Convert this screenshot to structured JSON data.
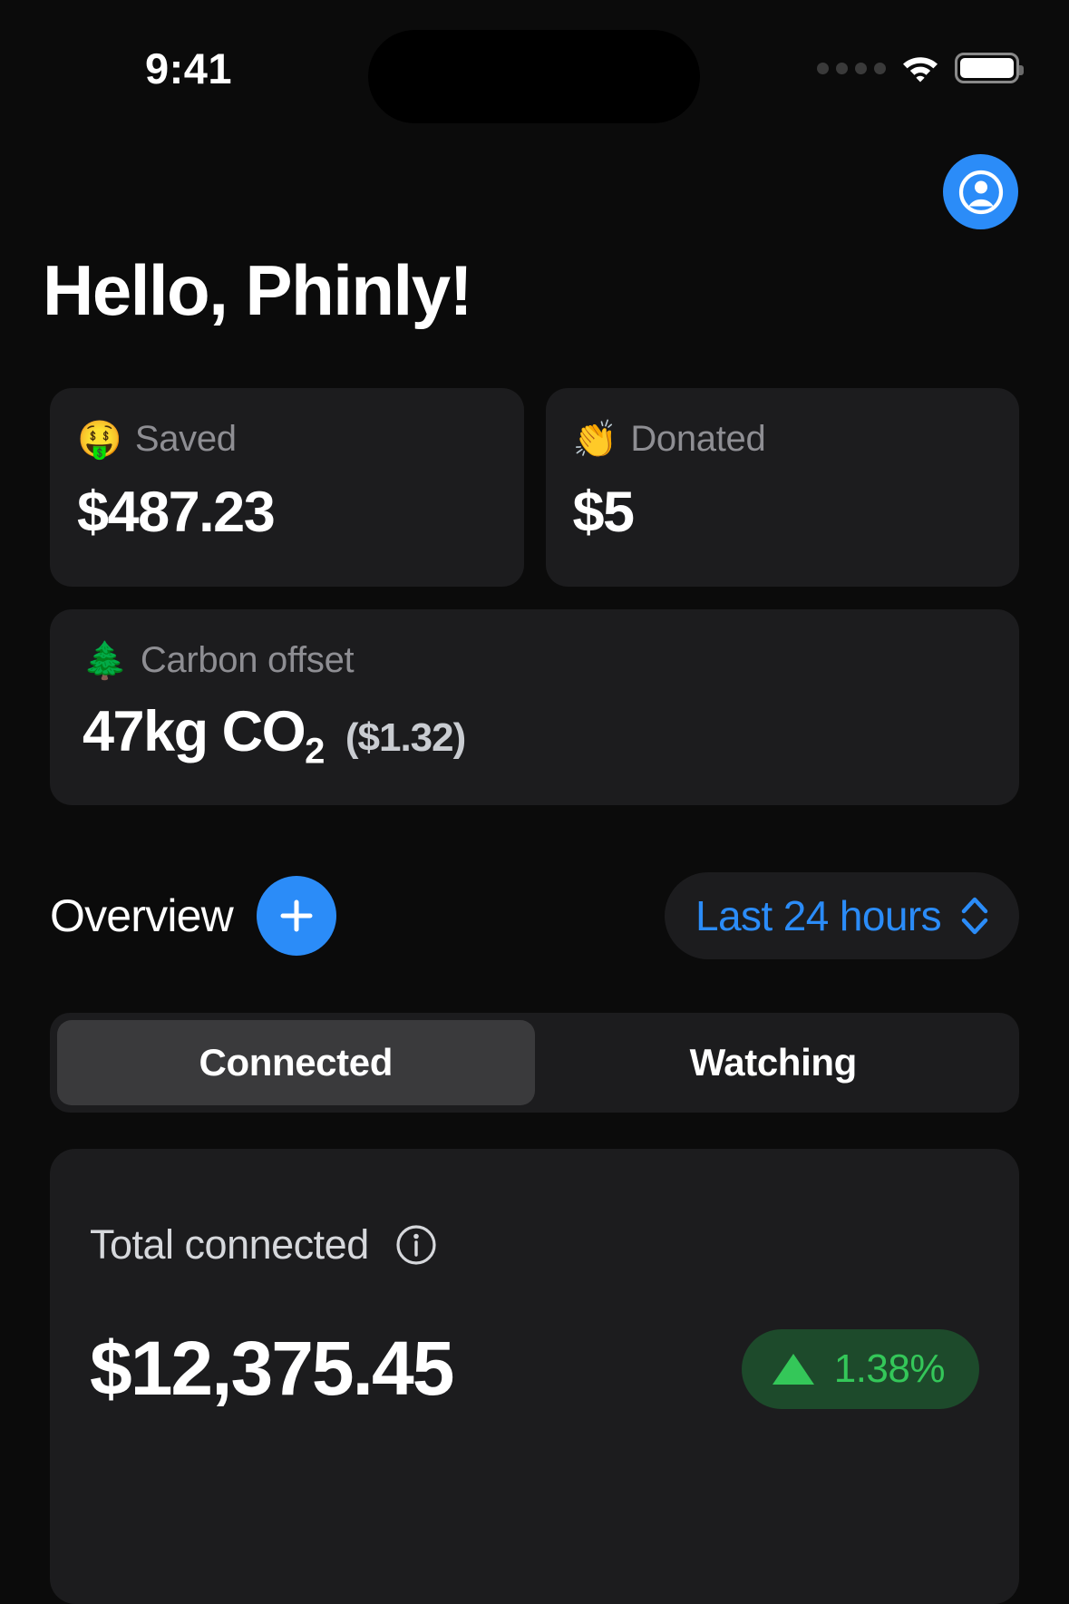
{
  "status_bar": {
    "time": "9:41",
    "signal_icon": "signal-dots-icon",
    "wifi_icon": "wifi-icon",
    "battery_icon": "battery-icon"
  },
  "header": {
    "avatar_icon": "account-circle-icon",
    "greeting": "Hello, Phinly!"
  },
  "stats": {
    "cards": [
      {
        "emoji": "🤑",
        "emoji_name": "money-mouth-face-emoji",
        "label": "Saved",
        "value": "$487.23"
      },
      {
        "emoji": "👏",
        "emoji_name": "clapping-hands-emoji",
        "label": "Donated",
        "value": "$5"
      }
    ],
    "carbon": {
      "emoji": "🌲",
      "emoji_name": "evergreen-tree-emoji",
      "label": "Carbon offset",
      "value_main": "47kg CO",
      "value_sub": "2",
      "value_cost": "($1.32)"
    }
  },
  "overview": {
    "title": "Overview",
    "add_icon": "plus-icon",
    "add_label": "Add",
    "range": {
      "selected": "Last 24 hours",
      "chevron_icon": "chevron-up-down-icon",
      "options": [
        "Last 24 hours"
      ]
    }
  },
  "segmented": {
    "tabs": [
      {
        "label": "Connected",
        "active": true
      },
      {
        "label": "Watching",
        "active": false
      }
    ]
  },
  "total": {
    "label": "Total connected",
    "info_icon": "info-circle-icon",
    "value": "$12,375.45",
    "change": {
      "direction_icon": "triangle-up-icon",
      "text": "1.38%",
      "color": "#34c759",
      "background": "#1d4a2b"
    }
  },
  "theme": {
    "background": "#0b0b0b",
    "card": "#1c1c1e",
    "accent": "#2b8cf8",
    "muted_text": "#8e8e93",
    "positive": "#34c759"
  }
}
